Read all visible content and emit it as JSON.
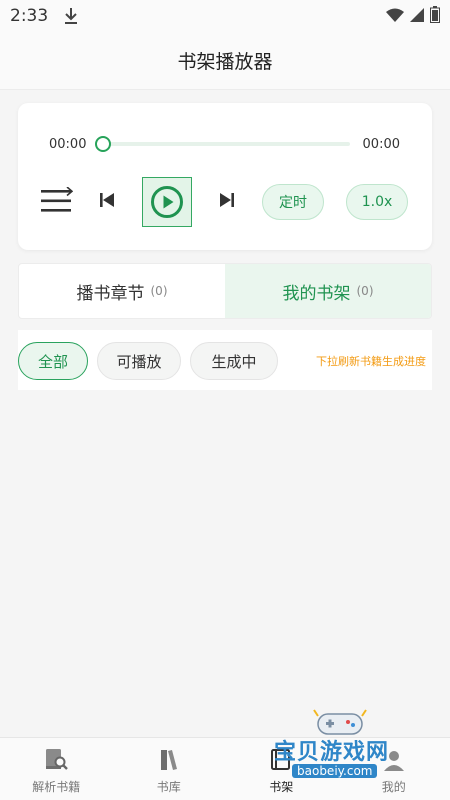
{
  "status": {
    "time": "2:33"
  },
  "header": {
    "title": "书架播放器"
  },
  "player": {
    "current_time": "00:00",
    "total_time": "00:00",
    "progress": 0,
    "timer_label": "定时",
    "speed_label": "1.0x"
  },
  "tabs": [
    {
      "label": "播书章节",
      "count": "(0)",
      "active": false
    },
    {
      "label": "我的书架",
      "count": "(0)",
      "active": true
    }
  ],
  "filters": {
    "chips": [
      "全部",
      "可播放",
      "生成中"
    ],
    "selected": "全部",
    "hint": "下拉刷新书籍生成进度"
  },
  "bottom_nav": [
    {
      "label": "解析书籍",
      "icon": "book-search-icon"
    },
    {
      "label": "书库",
      "icon": "library-icon"
    },
    {
      "label": "书架",
      "icon": "bookshelf-icon",
      "active": true
    },
    {
      "label": "我的",
      "icon": "profile-icon"
    }
  ],
  "watermark": {
    "title": "宝贝游戏网",
    "url": "baobeiy.com"
  },
  "colors": {
    "accent": "#27a35a",
    "accent_light": "#eaf6ee",
    "hint": "#f39b13",
    "watermark": "#2f86c8"
  }
}
